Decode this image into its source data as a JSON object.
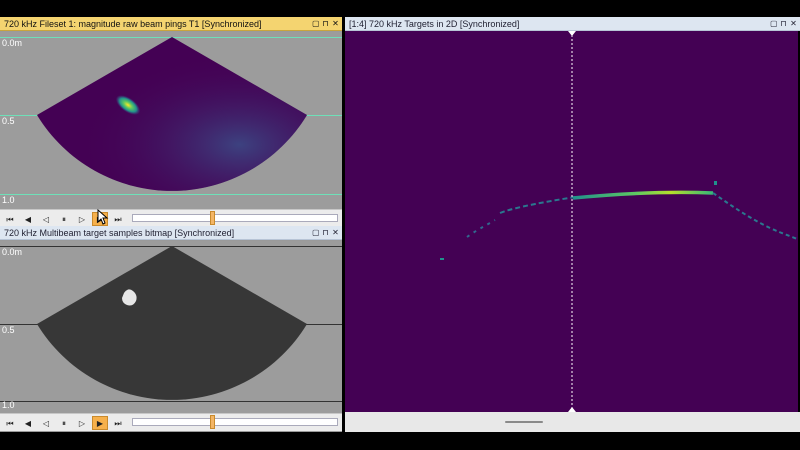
{
  "panels": {
    "top_left": {
      "title": "720 kHz Fileset 1: magnitude raw beam pings T1 [Synchronized]",
      "depth_labels": [
        "0.0m",
        "0.5",
        "1.0"
      ],
      "line_color": "#6ee0b8",
      "fan_color": "#440154",
      "slider_value": 0.4
    },
    "bottom_left": {
      "title": "720 kHz Multibeam target samples bitmap [Synchronized]",
      "depth_labels": [
        "0.0m",
        "0.5",
        "1.0"
      ],
      "fan_color": "#373737",
      "slider_value": 0.4
    },
    "right": {
      "title": "[1:4] 720 kHz Targets in 2D [Synchronized]",
      "background_color": "#440154"
    }
  },
  "window_buttons": [
    "▢",
    "⊓",
    "✕"
  ],
  "playback_icons": [
    "⏮",
    "◀",
    "◁",
    "⏸",
    "▷",
    "▶",
    "⏭"
  ],
  "colors": {
    "active_title": "#f4d470",
    "inactive_title": "#dde6f1",
    "toolbar_active": "#f6b04b"
  }
}
